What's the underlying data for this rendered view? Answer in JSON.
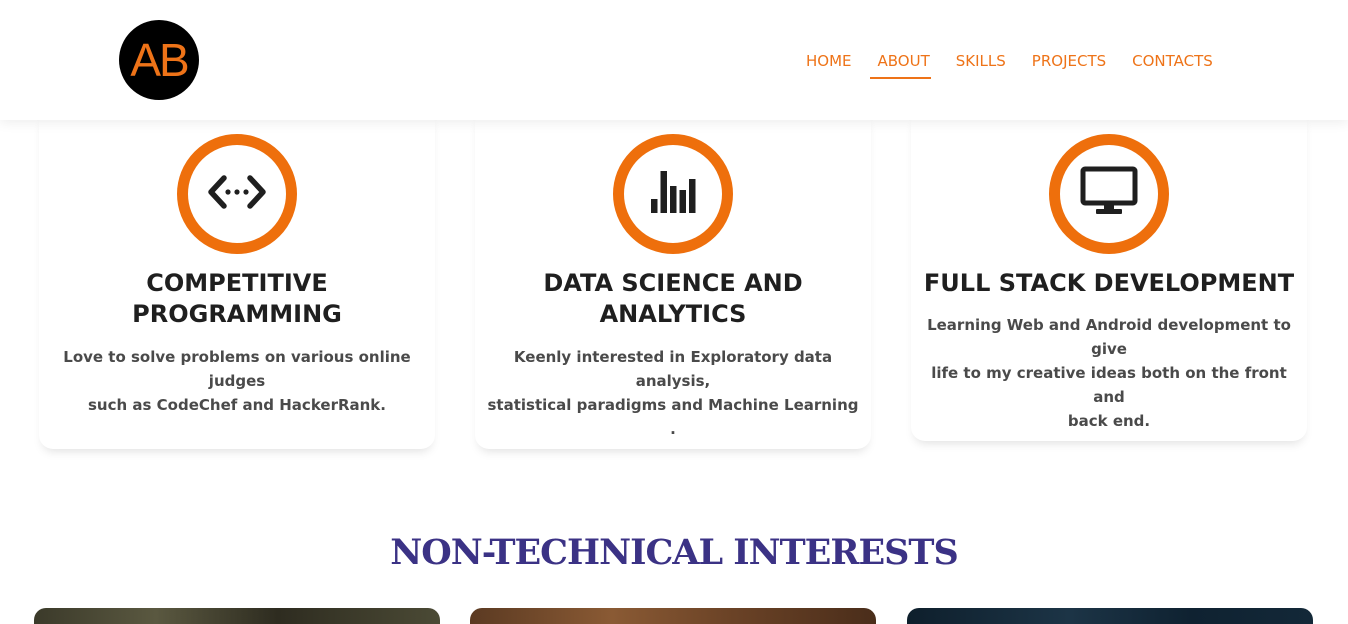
{
  "logo": {
    "text": "AB",
    "bg_color": "#000000",
    "text_color": "#ee7318"
  },
  "nav": {
    "items": [
      {
        "label": "HOME",
        "active": false
      },
      {
        "label": "ABOUT",
        "active": true
      },
      {
        "label": "SKILLS",
        "active": false
      },
      {
        "label": "PROJECTS",
        "active": false
      },
      {
        "label": "CONTACTS",
        "active": false
      }
    ],
    "color": "#ee7318"
  },
  "cards": [
    {
      "icon": "code-icon",
      "title_lines": [
        "COMPETITIVE",
        "PROGRAMMING"
      ],
      "text_lines": [
        "Love to solve problems on various online judges",
        "such as CodeChef and HackerRank."
      ]
    },
    {
      "icon": "bar-chart-icon",
      "title_lines": [
        "DATA SCIENCE AND",
        "ANALYTICS"
      ],
      "text_lines": [
        "Keenly interested in Exploratory data analysis,",
        "statistical paradigms and Machine Learning ."
      ]
    },
    {
      "icon": "desktop-icon",
      "title_lines": [
        "FULL STACK DEVELOPMENT"
      ],
      "text_lines": [
        "Learning Web and Android development to give",
        "life to my creative ideas both on the front and",
        "back end."
      ]
    }
  ],
  "accent_color": "#ee6f0c",
  "section": {
    "title": "NON-TECHNICAL INTERESTS",
    "color": "#3b3285"
  }
}
